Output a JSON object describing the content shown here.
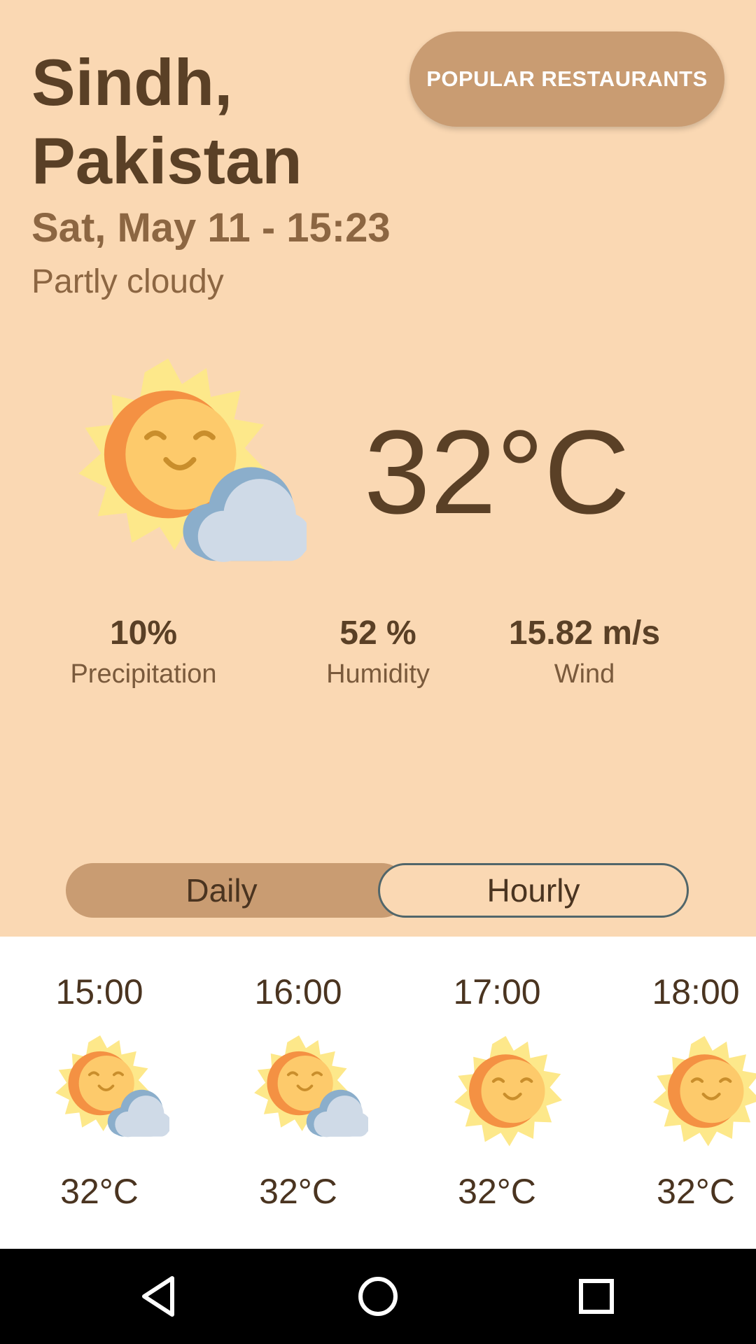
{
  "location": "Sindh, Pakistan",
  "datetime": "Sat, May 11 - 15:23",
  "condition": "Partly cloudy",
  "temperature": "32°C",
  "current_icon": "partly-cloudy-sun-icon",
  "popular_button_label": "POPULAR RESTAURANTS",
  "stats": {
    "precipitation": {
      "value": "10%",
      "label": "Precipitation"
    },
    "humidity": {
      "value": "52 %",
      "label": "Humidity"
    },
    "wind": {
      "value": "15.82 m/s",
      "label": "Wind"
    }
  },
  "toggle": {
    "daily": "Daily",
    "hourly": "Hourly",
    "selected": "Hourly"
  },
  "hourly": [
    {
      "time": "15:00",
      "icon": "partly-cloudy-sun-icon",
      "temp": "32°C"
    },
    {
      "time": "16:00",
      "icon": "partly-cloudy-sun-icon",
      "temp": "32°C"
    },
    {
      "time": "17:00",
      "icon": "sun-icon",
      "temp": "32°C"
    },
    {
      "time": "18:00",
      "icon": "sun-icon",
      "temp": "32°C"
    }
  ],
  "colors": {
    "background": "#FAD8B3",
    "accent": "#C99C72",
    "text_dark": "#5A4026",
    "text_medium": "#8C6642"
  }
}
